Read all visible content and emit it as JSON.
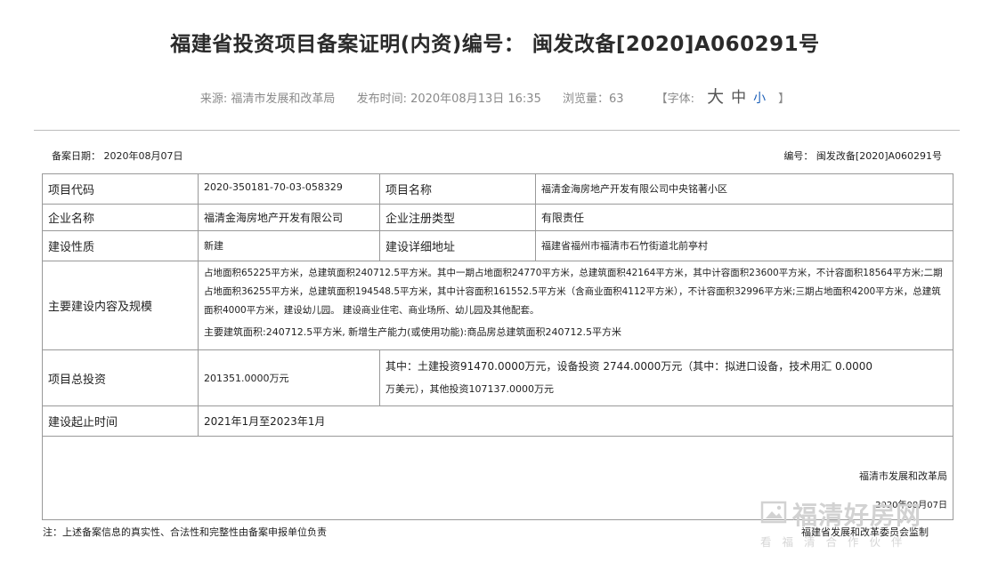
{
  "header": {
    "title": "福建省投资项目备案证明(内资)编号： 闽发改备[2020]A060291号",
    "source": "来源: 福清市发展和改革局",
    "publish_time": "发布时间: 2020年08月13日 16:35",
    "views": "浏览量：63",
    "font_label": "【字体:",
    "font_big": "大",
    "font_mid": "中",
    "font_small": "小",
    "font_close": "】"
  },
  "record": {
    "date": "备案日期： 2020年08月07日",
    "number": "编号： 闽发改备[2020]A060291号"
  },
  "table": {
    "project_code_label": "项目代码",
    "project_code": "2020-350181-70-03-058329",
    "project_name_label": "项目名称",
    "project_name": "福清金海房地产开发有限公司中央铭著小区",
    "company_label": "企业名称",
    "company": "福清金海房地产开发有限公司",
    "reg_type_label": "企业注册类型",
    "reg_type": "有限责任",
    "nature_label": "建设性质",
    "nature": "新建",
    "address_label": "建设详细地址",
    "address": "福建省福州市福清市石竹街道北前亭村",
    "scope_label": "主要建设内容及规模",
    "scope": "占地面积65225平方米，总建筑面积240712.5平方米。其中一期占地面积24770平方米，总建筑面积42164平方米，其中计容面积23600平方米，不计容面积18564平方米;二期占地面积36255平方米，总建筑面积194548.5平方米，其中计容面积161552.5平方米（含商业面积4112平方米），不计容面积32996平方米;三期占地面积4200平方米，总建筑面积4000平方米，建设幼儿园。 建设商业住宅、商业场所、幼儿园及其他配套。",
    "scope_extra": "主要建筑面积:240712.5平方米, 新增生产能力(或使用功能):商品房总建筑面积240712.5平方米",
    "investment_label": "项目总投资",
    "investment": "201351.0000万元",
    "investment_detail_1": "其中：土建投资91470.0000万元，设备投资 2744.0000万元（其中：拟进口设备，技术用汇 0.0000",
    "investment_detail_2": "万美元），其他投资107137.0000万元",
    "period_label": "建设起止时间",
    "period": "2021年1月至2023年1月",
    "sign_org": "福清市发展和改革局",
    "sign_date": "2020年08月07日"
  },
  "footer": {
    "note": "注：上述备案信息的真实性、合法性和完整性由备案申报单位负责",
    "issuer": "福建省发展和改革委员会监制"
  },
  "watermark": {
    "main": "福清好房网",
    "sub": "看福清合作伙伴",
    "icon": "house-photo-icon"
  }
}
